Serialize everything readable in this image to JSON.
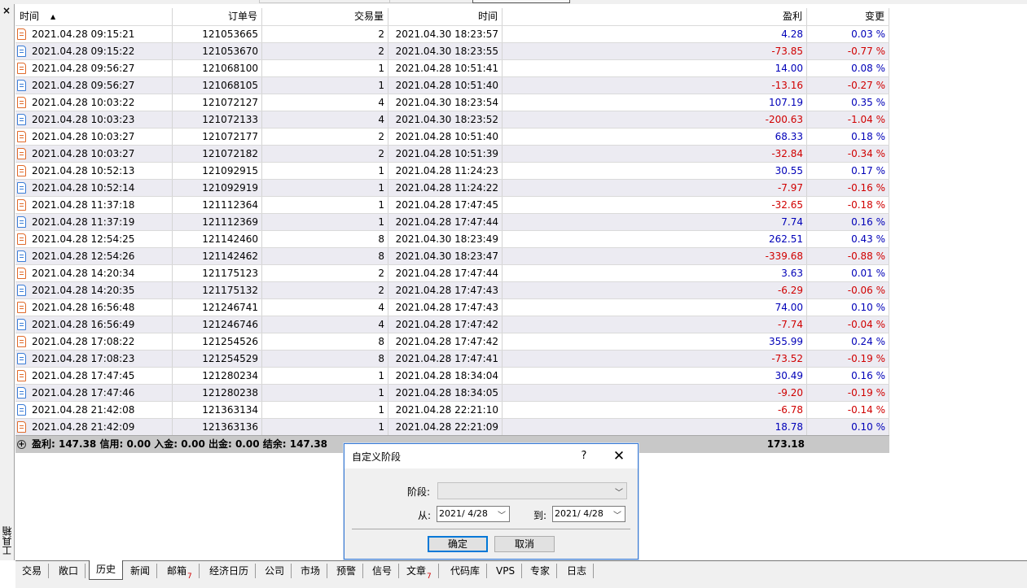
{
  "toolbox": {
    "close": "×",
    "label": "工具箱"
  },
  "columns": {
    "open_time": "时间",
    "ticket": "订单号",
    "volume": "交易量",
    "close_time": "时间",
    "profit": "盈利",
    "change": "变更"
  },
  "rows": [
    {
      "open_time": "2021.04.28 09:15:21",
      "ticket": "121053665",
      "volume": "2",
      "close_time": "2021.04.30 18:23:57",
      "profit": "4.28",
      "change": "0.03 %",
      "type": "sell"
    },
    {
      "open_time": "2021.04.28 09:15:22",
      "ticket": "121053670",
      "volume": "2",
      "close_time": "2021.04.30 18:23:55",
      "profit": "-73.85",
      "change": "-0.77 %",
      "type": "buy"
    },
    {
      "open_time": "2021.04.28 09:56:27",
      "ticket": "121068100",
      "volume": "1",
      "close_time": "2021.04.28 10:51:41",
      "profit": "14.00",
      "change": "0.08 %",
      "type": "sell"
    },
    {
      "open_time": "2021.04.28 09:56:27",
      "ticket": "121068105",
      "volume": "1",
      "close_time": "2021.04.28 10:51:40",
      "profit": "-13.16",
      "change": "-0.27 %",
      "type": "buy"
    },
    {
      "open_time": "2021.04.28 10:03:22",
      "ticket": "121072127",
      "volume": "4",
      "close_time": "2021.04.30 18:23:54",
      "profit": "107.19",
      "change": "0.35 %",
      "type": "sell"
    },
    {
      "open_time": "2021.04.28 10:03:23",
      "ticket": "121072133",
      "volume": "4",
      "close_time": "2021.04.30 18:23:52",
      "profit": "-200.63",
      "change": "-1.04 %",
      "type": "buy"
    },
    {
      "open_time": "2021.04.28 10:03:27",
      "ticket": "121072177",
      "volume": "2",
      "close_time": "2021.04.28 10:51:40",
      "profit": "68.33",
      "change": "0.18 %",
      "type": "sell"
    },
    {
      "open_time": "2021.04.28 10:03:27",
      "ticket": "121072182",
      "volume": "2",
      "close_time": "2021.04.28 10:51:39",
      "profit": "-32.84",
      "change": "-0.34 %",
      "type": "sell"
    },
    {
      "open_time": "2021.04.28 10:52:13",
      "ticket": "121092915",
      "volume": "1",
      "close_time": "2021.04.28 11:24:23",
      "profit": "30.55",
      "change": "0.17 %",
      "type": "sell"
    },
    {
      "open_time": "2021.04.28 10:52:14",
      "ticket": "121092919",
      "volume": "1",
      "close_time": "2021.04.28 11:24:22",
      "profit": "-7.97",
      "change": "-0.16 %",
      "type": "buy"
    },
    {
      "open_time": "2021.04.28 11:37:18",
      "ticket": "121112364",
      "volume": "1",
      "close_time": "2021.04.28 17:47:45",
      "profit": "-32.65",
      "change": "-0.18 %",
      "type": "sell"
    },
    {
      "open_time": "2021.04.28 11:37:19",
      "ticket": "121112369",
      "volume": "1",
      "close_time": "2021.04.28 17:47:44",
      "profit": "7.74",
      "change": "0.16 %",
      "type": "buy"
    },
    {
      "open_time": "2021.04.28 12:54:25",
      "ticket": "121142460",
      "volume": "8",
      "close_time": "2021.04.30 18:23:49",
      "profit": "262.51",
      "change": "0.43 %",
      "type": "sell"
    },
    {
      "open_time": "2021.04.28 12:54:26",
      "ticket": "121142462",
      "volume": "8",
      "close_time": "2021.04.30 18:23:47",
      "profit": "-339.68",
      "change": "-0.88 %",
      "type": "buy"
    },
    {
      "open_time": "2021.04.28 14:20:34",
      "ticket": "121175123",
      "volume": "2",
      "close_time": "2021.04.28 17:47:44",
      "profit": "3.63",
      "change": "0.01 %",
      "type": "sell"
    },
    {
      "open_time": "2021.04.28 14:20:35",
      "ticket": "121175132",
      "volume": "2",
      "close_time": "2021.04.28 17:47:43",
      "profit": "-6.29",
      "change": "-0.06 %",
      "type": "buy"
    },
    {
      "open_time": "2021.04.28 16:56:48",
      "ticket": "121246741",
      "volume": "4",
      "close_time": "2021.04.28 17:47:43",
      "profit": "74.00",
      "change": "0.10 %",
      "type": "sell"
    },
    {
      "open_time": "2021.04.28 16:56:49",
      "ticket": "121246746",
      "volume": "4",
      "close_time": "2021.04.28 17:47:42",
      "profit": "-7.74",
      "change": "-0.04 %",
      "type": "buy"
    },
    {
      "open_time": "2021.04.28 17:08:22",
      "ticket": "121254526",
      "volume": "8",
      "close_time": "2021.04.28 17:47:42",
      "profit": "355.99",
      "change": "0.24 %",
      "type": "sell"
    },
    {
      "open_time": "2021.04.28 17:08:23",
      "ticket": "121254529",
      "volume": "8",
      "close_time": "2021.04.28 17:47:41",
      "profit": "-73.52",
      "change": "-0.19 %",
      "type": "buy"
    },
    {
      "open_time": "2021.04.28 17:47:45",
      "ticket": "121280234",
      "volume": "1",
      "close_time": "2021.04.28 18:34:04",
      "profit": "30.49",
      "change": "0.16 %",
      "type": "sell"
    },
    {
      "open_time": "2021.04.28 17:47:46",
      "ticket": "121280238",
      "volume": "1",
      "close_time": "2021.04.28 18:34:05",
      "profit": "-9.20",
      "change": "-0.19 %",
      "type": "buy"
    },
    {
      "open_time": "2021.04.28 21:42:08",
      "ticket": "121363134",
      "volume": "1",
      "close_time": "2021.04.28 22:21:10",
      "profit": "-6.78",
      "change": "-0.14 %",
      "type": "buy"
    },
    {
      "open_time": "2021.04.28 21:42:09",
      "ticket": "121363136",
      "volume": "1",
      "close_time": "2021.04.28 22:21:09",
      "profit": "18.78",
      "change": "0.10 %",
      "type": "sell"
    }
  ],
  "summary": {
    "text": "盈利: 147.38  信用: 0.00  入金: 0.00  出金: 0.00  结余: 147.38",
    "total_profit": "173.18"
  },
  "dialog": {
    "title": "自定义阶段",
    "help": "?",
    "close": "✕",
    "period_label": "阶段:",
    "period_value": "",
    "from_label": "从:",
    "from_date": "2021/ 4/28",
    "to_label": "到:",
    "to_date": "2021/ 4/28",
    "ok": "确定",
    "cancel": "取消"
  },
  "tabs": [
    {
      "label": "交易"
    },
    {
      "label": "敞口"
    },
    {
      "label": "历史",
      "active": true
    },
    {
      "label": "新闻"
    },
    {
      "label": "邮箱",
      "badge": "7"
    },
    {
      "label": "经济日历"
    },
    {
      "label": "公司"
    },
    {
      "label": "市场"
    },
    {
      "label": "预警"
    },
    {
      "label": "信号"
    },
    {
      "label": "文章",
      "badge": "7"
    },
    {
      "label": "代码库"
    },
    {
      "label": "VPS"
    },
    {
      "label": "专家"
    },
    {
      "label": "日志"
    }
  ],
  "colors": {
    "positive": "#0000b8",
    "negative": "#d00000",
    "accent": "#0078d7"
  }
}
